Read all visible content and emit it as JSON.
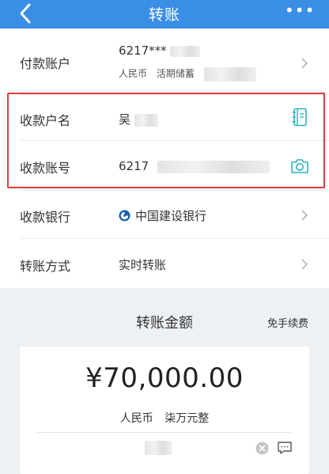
{
  "header": {
    "title": "转账",
    "more_label": "•••"
  },
  "payer": {
    "label": "付款账户",
    "account_masked": "6217***",
    "currency": "人民币",
    "account_type": "活期储蓄"
  },
  "payee_name": {
    "label": "收款户名",
    "value": "吴"
  },
  "payee_account": {
    "label": "收款账号",
    "value": "6217"
  },
  "bank": {
    "label": "收款银行",
    "value": "中国建设银行"
  },
  "method": {
    "label": "转账方式",
    "value": "实时转账"
  },
  "amount": {
    "title": "转账金额",
    "fee": "免手续费",
    "value": "¥70,000.00",
    "currency": "人民币",
    "words": "柒万元整"
  },
  "colors": {
    "header_bg": "#3a8ee6",
    "highlight": "#e23a3a",
    "icon_teal": "#2bb3c0",
    "section_bg": "#eef1f4"
  }
}
